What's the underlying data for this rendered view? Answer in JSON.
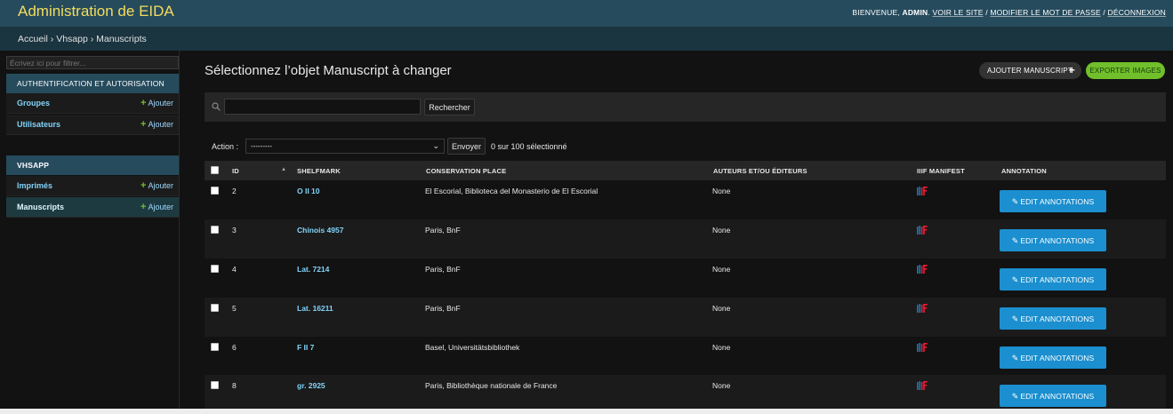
{
  "header": {
    "site_title": "Administration de EIDA",
    "welcome": "Bienvenue,",
    "username": "admin",
    "view_site": "Voir le site",
    "change_password": "Modifier le mot de passe",
    "logout": "Déconnexion",
    "sep": "/"
  },
  "breadcrumbs": {
    "home": "Accueil",
    "app": "Vhsapp",
    "current": "Manuscripts",
    "sep": "›"
  },
  "sidebar": {
    "filter_placeholder": "Écrivez ici pour filtrer...",
    "add_label": "Ajouter",
    "apps": [
      {
        "name": "Authentification et autorisation",
        "models": [
          "Groupes",
          "Utilisateurs"
        ]
      },
      {
        "name": "VHSAPP",
        "models": [
          "Imprimés",
          "Manuscripts"
        ]
      }
    ]
  },
  "content": {
    "title": "Sélectionnez l’objet Manuscript à changer",
    "add_button": "Ajouter Manuscript",
    "add_icon": "plus-icon",
    "export_button": "Exporter images",
    "search_button": "Rechercher",
    "search_value": "",
    "action_label": "Action :",
    "action_selected": "---------",
    "go_button": "Envoyer",
    "counter": "0 sur 100 sélectionné"
  },
  "table": {
    "columns": {
      "id": "ID",
      "shelfmark": "Shelfmark",
      "conservation_place": "Conservation place",
      "authors": "Auteurs et/ou éditeurs",
      "iiif": "IIIF Manifest",
      "annotation": "Annotation"
    },
    "edit_label": "Edit annotations",
    "rows": [
      {
        "id": "2",
        "shelfmark": "O II 10",
        "place": "El Escorial, Biblioteca del Monasterio de El Escorial",
        "authors": "None"
      },
      {
        "id": "3",
        "shelfmark": "Chinois 4957",
        "place": "Paris, BnF",
        "authors": "None"
      },
      {
        "id": "4",
        "shelfmark": "Lat. 7214",
        "place": "Paris, BnF",
        "authors": "None"
      },
      {
        "id": "5",
        "shelfmark": "Lat. 16211",
        "place": "Paris, BnF",
        "authors": "None"
      },
      {
        "id": "6",
        "shelfmark": "F II 7",
        "place": "Basel, Universitätsbibliothek",
        "authors": "None"
      },
      {
        "id": "8",
        "shelfmark": "gr. 2925",
        "place": "Paris, Bibliothèque nationale de France",
        "authors": "None"
      }
    ]
  },
  "colors": {
    "header_bg": "#264b5d",
    "title_yellow": "#f5dd5d",
    "link_blue": "#81d4fa",
    "green": "#70bf2b",
    "button_blue": "#1b8fcf"
  }
}
